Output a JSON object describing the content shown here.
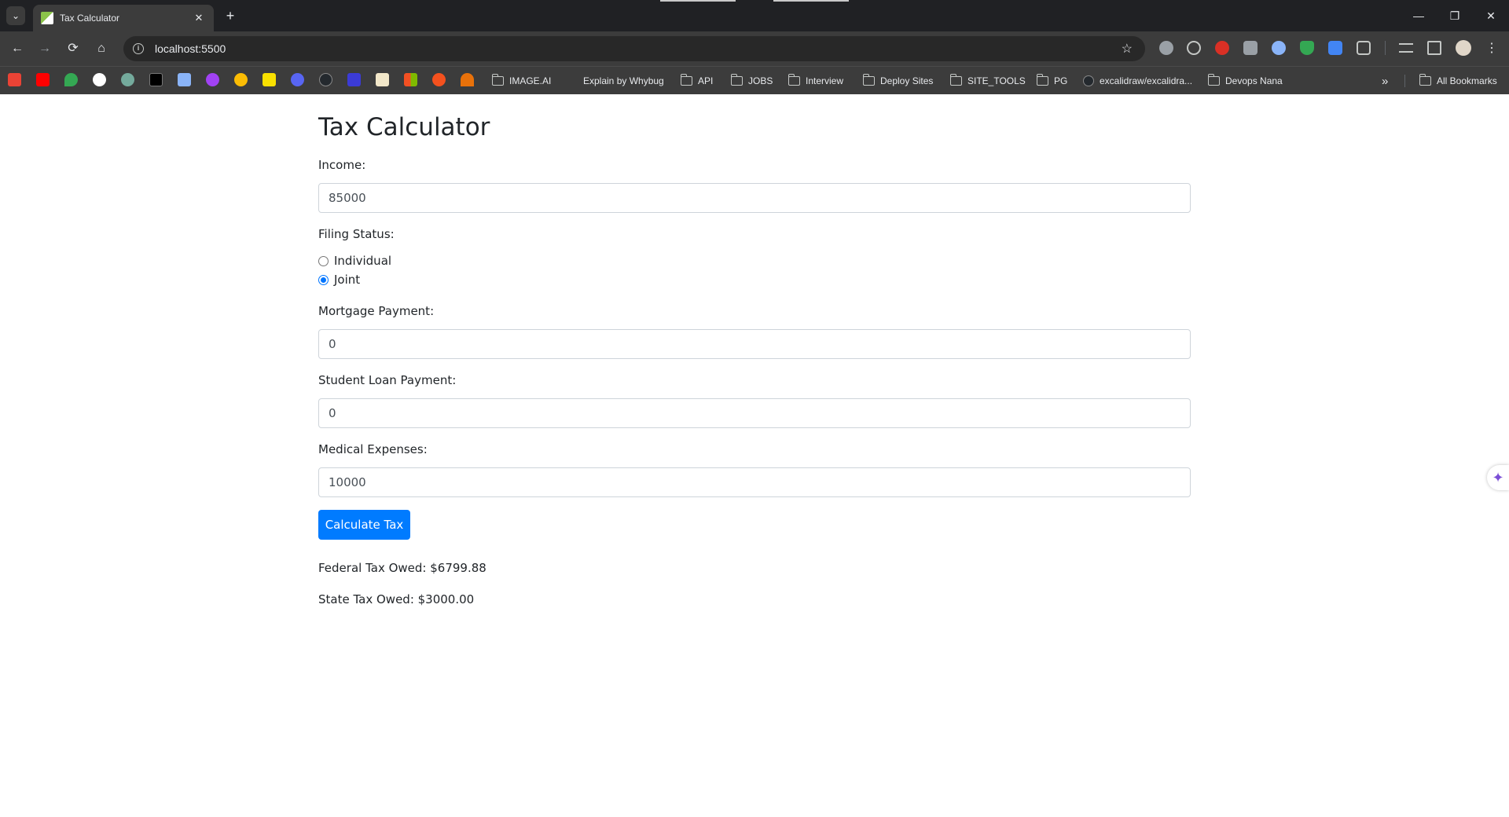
{
  "browser": {
    "tab_title": "Tax Calculator",
    "url": "localhost:5500",
    "bookmarks": [
      {
        "label": "IMAGE.AI",
        "type": "bookmark"
      },
      {
        "label": "Explain by Whybug",
        "type": "bookmark"
      },
      {
        "label": "API",
        "type": "folder"
      },
      {
        "label": "JOBS",
        "type": "folder"
      },
      {
        "label": "Interview",
        "type": "folder"
      },
      {
        "label": "Deploy Sites",
        "type": "folder"
      },
      {
        "label": "SITE_TOOLS",
        "type": "folder"
      },
      {
        "label": "PG",
        "type": "folder"
      },
      {
        "label": "excalidraw/excalidra...",
        "type": "bookmark"
      },
      {
        "label": "Devops Nana",
        "type": "folder"
      }
    ],
    "all_bookmarks_label": "All Bookmarks",
    "icons": {
      "back": "←",
      "forward": "→",
      "reload": "⟳",
      "home": "⌂",
      "star": "☆",
      "minimize": "—",
      "restore": "❐",
      "close": "✕",
      "new_tab": "+",
      "tab_close": "✕",
      "tab_search": "⌄",
      "more_bookmarks": "»",
      "menu": "⋮",
      "sparkle": "✦"
    }
  },
  "app": {
    "title": "Tax Calculator",
    "income": {
      "label": "Income:",
      "value": "85000"
    },
    "filing_status": {
      "label": "Filing Status:",
      "options": [
        {
          "label": "Individual",
          "checked": false
        },
        {
          "label": "Joint",
          "checked": true
        }
      ]
    },
    "mortgage": {
      "label": "Mortgage Payment:",
      "value": "0"
    },
    "student_loan": {
      "label": "Student Loan Payment:",
      "value": "0"
    },
    "medical": {
      "label": "Medical Expenses:",
      "value": "10000"
    },
    "calculate_button": "Calculate Tax",
    "federal_result": "Federal Tax Owed: $6799.88",
    "state_result": "State Tax Owed: $3000.00"
  },
  "colors": {
    "primary_button": "#007bff",
    "chrome_dark": "#202124",
    "chrome_toolbar": "#3c3c3c"
  }
}
